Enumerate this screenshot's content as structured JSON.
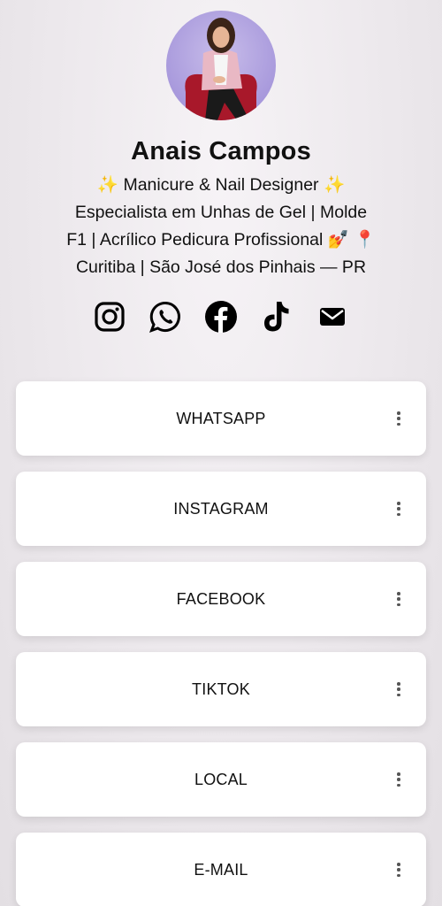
{
  "profile": {
    "name": "Anais Campos",
    "bio_lines": [
      "✨ Manicure & Nail Designer ✨",
      "Especialista em Unhas de Gel | Molde",
      "F1 | Acrílico Pedicura Profissional 💅 📍",
      "Curitiba | São José dos Pinhais — PR"
    ]
  },
  "socials": [
    {
      "icon": "instagram-icon"
    },
    {
      "icon": "whatsapp-icon"
    },
    {
      "icon": "facebook-icon"
    },
    {
      "icon": "tiktok-icon"
    },
    {
      "icon": "email-icon"
    }
  ],
  "links": [
    {
      "label": "WHATSAPP"
    },
    {
      "label": "INSTAGRAM"
    },
    {
      "label": "FACEBOOK"
    },
    {
      "label": "TIKTOK"
    },
    {
      "label": "LOCAL"
    },
    {
      "label": "E-MAIL"
    }
  ],
  "colors": {
    "background": "#ece8ec",
    "card": "#ffffff",
    "text": "#111111",
    "avatar_bg": "#a899dc"
  }
}
